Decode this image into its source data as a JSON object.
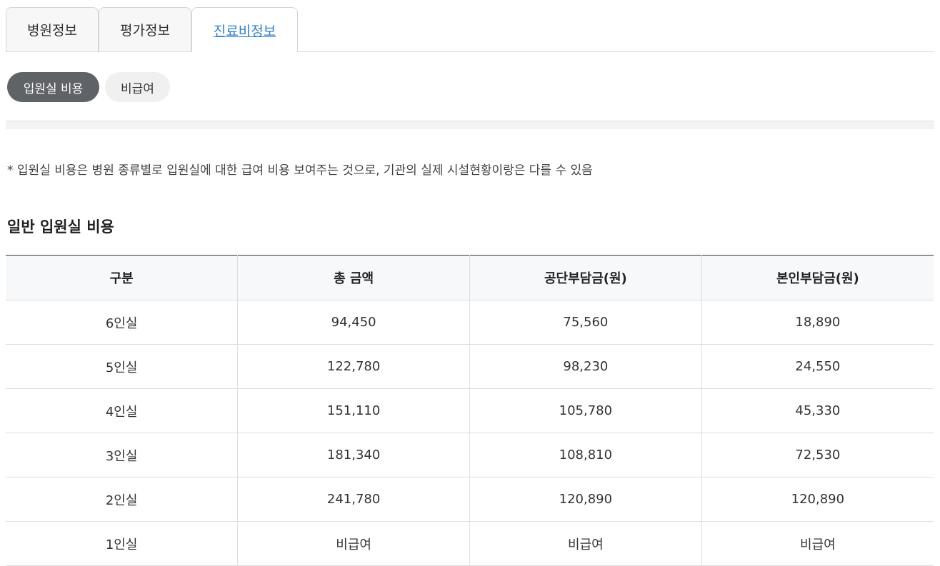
{
  "tabs": [
    {
      "label": "병원정보",
      "active": false
    },
    {
      "label": "평가정보",
      "active": false
    },
    {
      "label": "진료비정보",
      "active": true
    }
  ],
  "subtabs": [
    {
      "label": "입원실 비용",
      "active": true
    },
    {
      "label": "비급여",
      "active": false
    }
  ],
  "note": "* 입원실 비용은 병원 종류별로 입원실에 대한 급여 비용 보여주는 것으로, 기관의 실제 시설현황이랑은 다를 수 있음",
  "section_title": "일반 입원실 비용",
  "table": {
    "headers": [
      "구분",
      "총 금액",
      "공단부담금(원)",
      "본인부담금(원)"
    ],
    "rows": [
      [
        "6인실",
        "94,450",
        "75,560",
        "18,890"
      ],
      [
        "5인실",
        "122,780",
        "98,230",
        "24,550"
      ],
      [
        "4인실",
        "151,110",
        "105,780",
        "45,330"
      ],
      [
        "3인실",
        "181,340",
        "108,810",
        "72,530"
      ],
      [
        "2인실",
        "241,780",
        "120,890",
        "120,890"
      ],
      [
        "1인실",
        "비급여",
        "비급여",
        "비급여"
      ]
    ]
  },
  "colors": {
    "active_tab_text": "#2b7fd6",
    "active_pill_bg": "#5f6266",
    "inactive_pill_bg": "#f0f0f0",
    "header_bg": "#f7f8fa"
  }
}
